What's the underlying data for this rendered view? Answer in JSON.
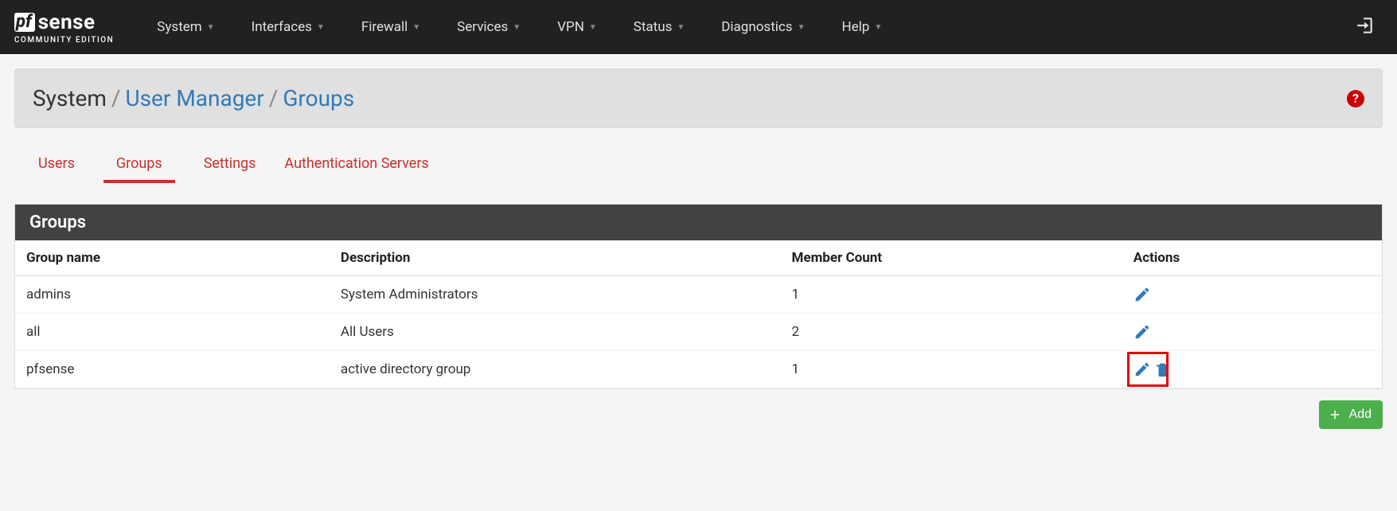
{
  "brand": {
    "pf": "pf",
    "sense": "sense",
    "edition": "COMMUNITY EDITION"
  },
  "nav": {
    "items": [
      {
        "label": "System"
      },
      {
        "label": "Interfaces"
      },
      {
        "label": "Firewall"
      },
      {
        "label": "Services"
      },
      {
        "label": "VPN"
      },
      {
        "label": "Status"
      },
      {
        "label": "Diagnostics"
      },
      {
        "label": "Help"
      }
    ]
  },
  "breadcrumb": {
    "root": "System",
    "sep": "/",
    "link1": "User Manager",
    "link2": "Groups"
  },
  "help_glyph": "?",
  "tabs": [
    {
      "label": "Users",
      "active": false
    },
    {
      "label": "Groups",
      "active": true
    },
    {
      "label": "Settings",
      "active": false
    },
    {
      "label": "Authentication Servers",
      "active": false
    }
  ],
  "panel": {
    "title": "Groups",
    "columns": {
      "name": "Group name",
      "desc": "Description",
      "count": "Member Count",
      "actions": "Actions"
    },
    "rows": [
      {
        "name": "admins",
        "desc": "System Administrators",
        "count": "1",
        "deletable": false,
        "highlighted": false
      },
      {
        "name": "all",
        "desc": "All Users",
        "count": "2",
        "deletable": false,
        "highlighted": false
      },
      {
        "name": "pfsense",
        "desc": "active directory group",
        "count": "1",
        "deletable": true,
        "highlighted": true
      }
    ]
  },
  "buttons": {
    "add": "Add"
  }
}
